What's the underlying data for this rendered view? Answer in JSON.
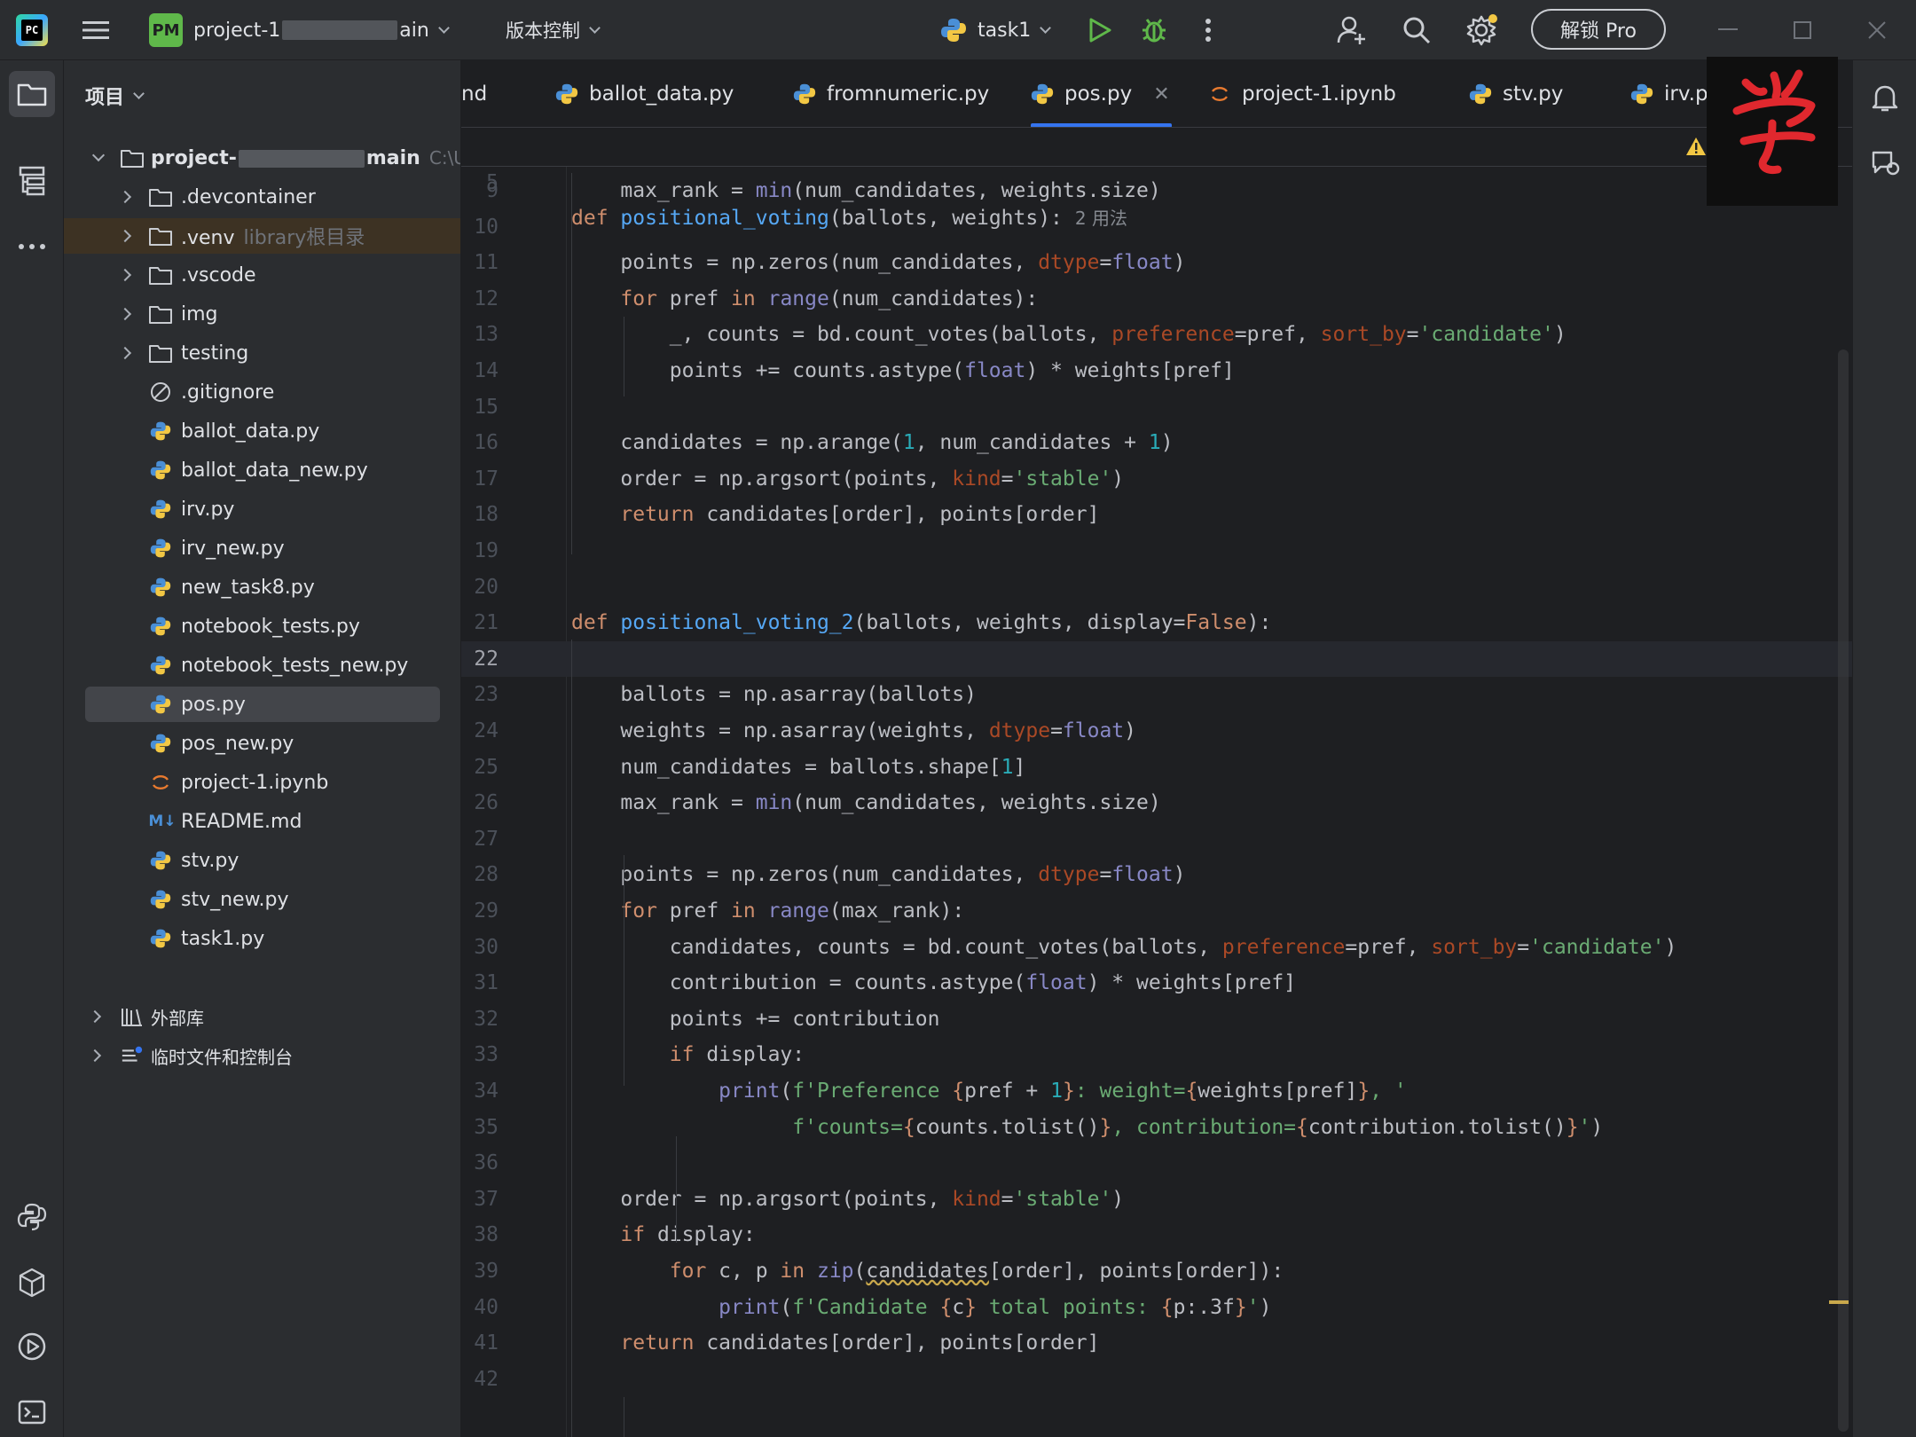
{
  "titlebar": {
    "project_badge": "PM",
    "project_name_prefix": "project-1",
    "project_name_suffix": "ain",
    "vcs_label": "版本控制",
    "run_config": "task1",
    "unlock_label": "解锁 Pro"
  },
  "project_panel": {
    "header": "项目",
    "root": {
      "prefix": "project-",
      "suffix": "main",
      "path_hint": "C:\\Us"
    },
    "items": [
      {
        "type": "folder",
        "label": ".devcontainer",
        "hint": ""
      },
      {
        "type": "folder",
        "label": ".venv",
        "hint": "library根目录"
      },
      {
        "type": "folder",
        "label": ".vscode",
        "hint": ""
      },
      {
        "type": "folder",
        "label": "img",
        "hint": ""
      },
      {
        "type": "folder",
        "label": "testing",
        "hint": ""
      },
      {
        "type": "ignore",
        "label": ".gitignore",
        "hint": ""
      },
      {
        "type": "python",
        "label": "ballot_data.py",
        "hint": ""
      },
      {
        "type": "python",
        "label": "ballot_data_new.py",
        "hint": ""
      },
      {
        "type": "python",
        "label": "irv.py",
        "hint": ""
      },
      {
        "type": "python",
        "label": "irv_new.py",
        "hint": ""
      },
      {
        "type": "python",
        "label": "new_task8.py",
        "hint": ""
      },
      {
        "type": "python",
        "label": "notebook_tests.py",
        "hint": ""
      },
      {
        "type": "python",
        "label": "notebook_tests_new.py",
        "hint": ""
      },
      {
        "type": "python",
        "label": "pos.py",
        "hint": ""
      },
      {
        "type": "python",
        "label": "pos_new.py",
        "hint": ""
      },
      {
        "type": "notebook",
        "label": "project-1.ipynb",
        "hint": ""
      },
      {
        "type": "markdown",
        "label": "README.md",
        "hint": ""
      },
      {
        "type": "python",
        "label": "stv.py",
        "hint": ""
      },
      {
        "type": "python",
        "label": "stv_new.py",
        "hint": ""
      },
      {
        "type": "python",
        "label": "task1.py",
        "hint": ""
      }
    ],
    "external_libs": "外部库",
    "scratches": "临时文件和控制台",
    "markdown_badge": "M↓"
  },
  "tabs": [
    {
      "label": "nd",
      "icon": "none"
    },
    {
      "label": "ballot_data.py",
      "icon": "python"
    },
    {
      "label": "fromnumeric.py",
      "icon": "python"
    },
    {
      "label": "pos.py",
      "icon": "python",
      "active": true,
      "close": "✕"
    },
    {
      "label": "project-1.ipynb",
      "icon": "notebook"
    },
    {
      "label": "stv.py",
      "icon": "python"
    },
    {
      "label": "irv.p",
      "icon": "python"
    }
  ],
  "editor": {
    "sticky": {
      "line": "5",
      "usages": "2 用法"
    },
    "lines": [
      "9",
      "10",
      "11",
      "12",
      "13",
      "14",
      "15",
      "16",
      "17",
      "18",
      "19",
      "20",
      "21",
      "22",
      "23",
      "24",
      "25",
      "26",
      "27",
      "28",
      "29",
      "30",
      "31",
      "32",
      "33",
      "34",
      "35",
      "36",
      "37",
      "38",
      "39",
      "40",
      "41",
      "42"
    ],
    "current_line": "22"
  },
  "colors": {
    "accent": "#3574f0",
    "keyword": "#cf8e6d",
    "function": "#56a8f5",
    "string": "#6aab73",
    "number": "#2aacb8",
    "builtin": "#8888c6",
    "kwarg": "#aa4926",
    "text": "#bcbec4"
  }
}
